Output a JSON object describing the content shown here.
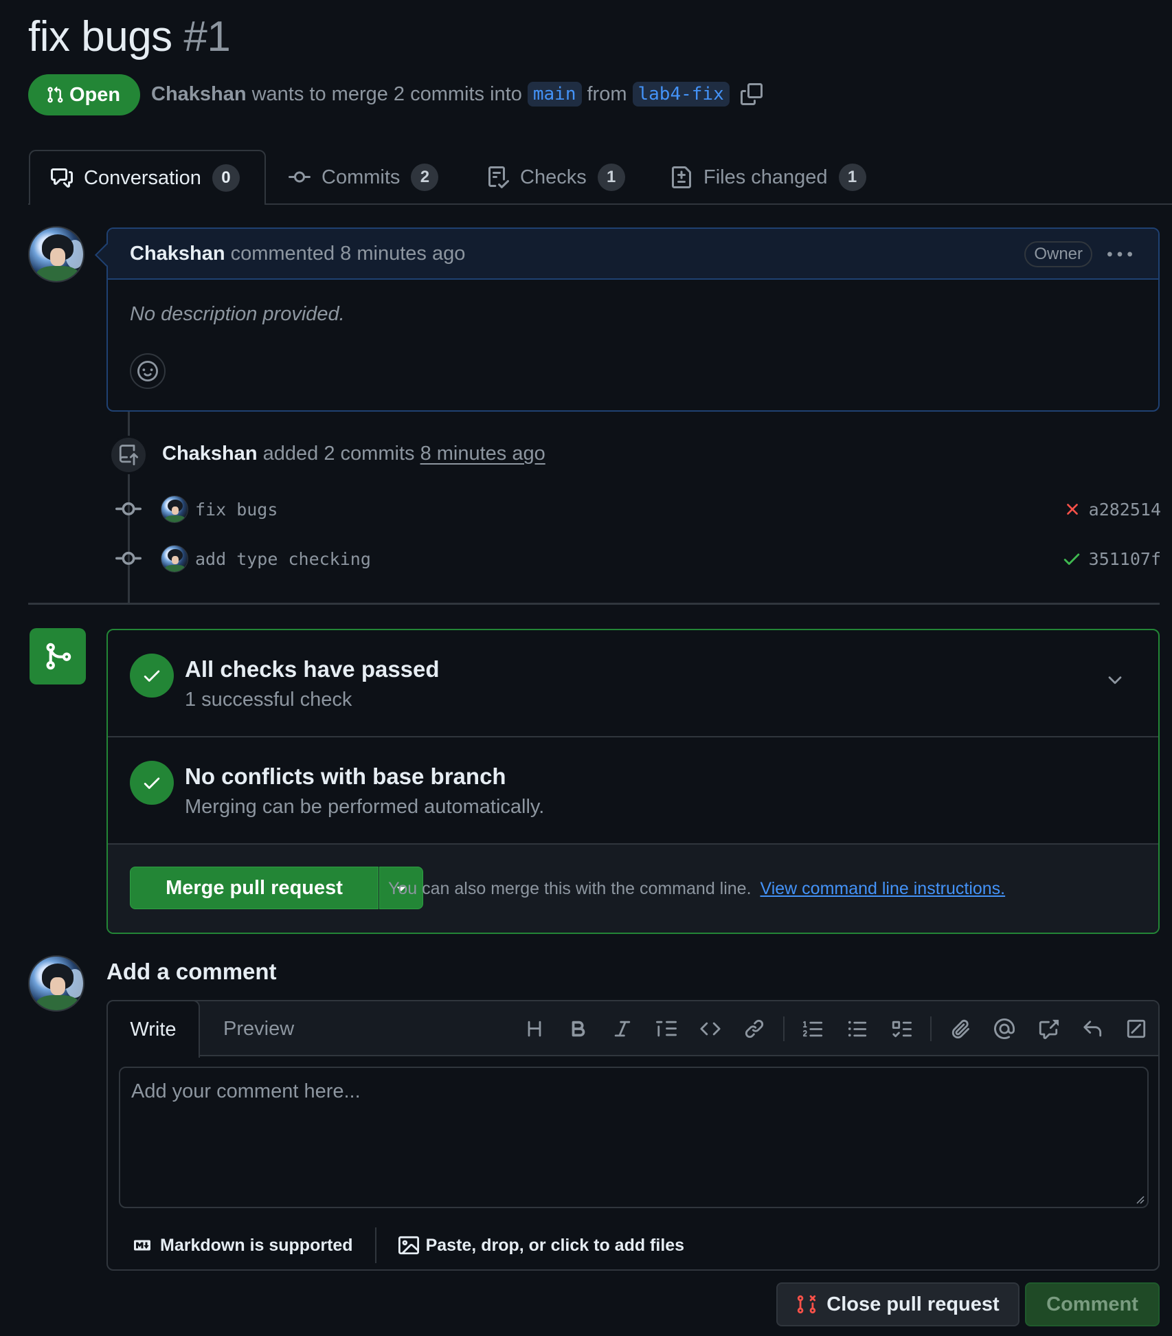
{
  "pr": {
    "title": "fix bugs",
    "number": "#1",
    "state": "Open",
    "author": "Chakshan",
    "merge_text": "wants to merge 2 commits into",
    "base_branch": "main",
    "from_word": "from",
    "head_branch": "lab4-fix"
  },
  "tabs": [
    {
      "label": "Conversation",
      "count": "0",
      "icon": "comment-discussion-icon"
    },
    {
      "label": "Commits",
      "count": "2",
      "icon": "git-commit-icon"
    },
    {
      "label": "Checks",
      "count": "1",
      "icon": "checklist-icon"
    },
    {
      "label": "Files changed",
      "count": "1",
      "icon": "file-diff-icon"
    }
  ],
  "comment": {
    "author": "Chakshan",
    "action": "commented 8 minutes ago",
    "badge": "Owner",
    "body": "No description provided."
  },
  "event": {
    "author": "Chakshan",
    "text": "added 2 commits",
    "time": "8 minutes ago"
  },
  "commits": [
    {
      "message": "fix bugs",
      "sha": "a282514",
      "status": "failed"
    },
    {
      "message": "add type checking",
      "sha": "351107f",
      "status": "passed"
    }
  ],
  "merge_box": {
    "checks_title": "All checks have passed",
    "checks_sub": "1 successful check",
    "conflicts_title": "No conflicts with base branch",
    "conflicts_sub": "Merging can be performed automatically.",
    "merge_button": "Merge pull request",
    "hint": "You can also merge this with the command line.",
    "hint_link": "View command line instructions."
  },
  "add_comment": {
    "title": "Add a comment",
    "tab_write": "Write",
    "tab_preview": "Preview",
    "placeholder": "Add your comment here...",
    "markdown_note": "Markdown is supported",
    "files_note": "Paste, drop, or click to add files",
    "toolbar_icons": [
      "heading-icon",
      "bold-icon",
      "italic-icon",
      "quote-icon",
      "code-icon",
      "link-icon",
      "ordered-list-icon",
      "unordered-list-icon",
      "task-list-icon",
      "attach-icon",
      "mention-icon",
      "cross-reference-icon",
      "reply-icon",
      "slash-command-icon"
    ]
  },
  "actions": {
    "close": "Close pull request",
    "comment": "Comment"
  },
  "colors": {
    "background": "#0d1117",
    "open_green": "#238636",
    "link_blue": "#4493f8",
    "fail_red": "#f85149",
    "success_green": "#3fb950"
  }
}
